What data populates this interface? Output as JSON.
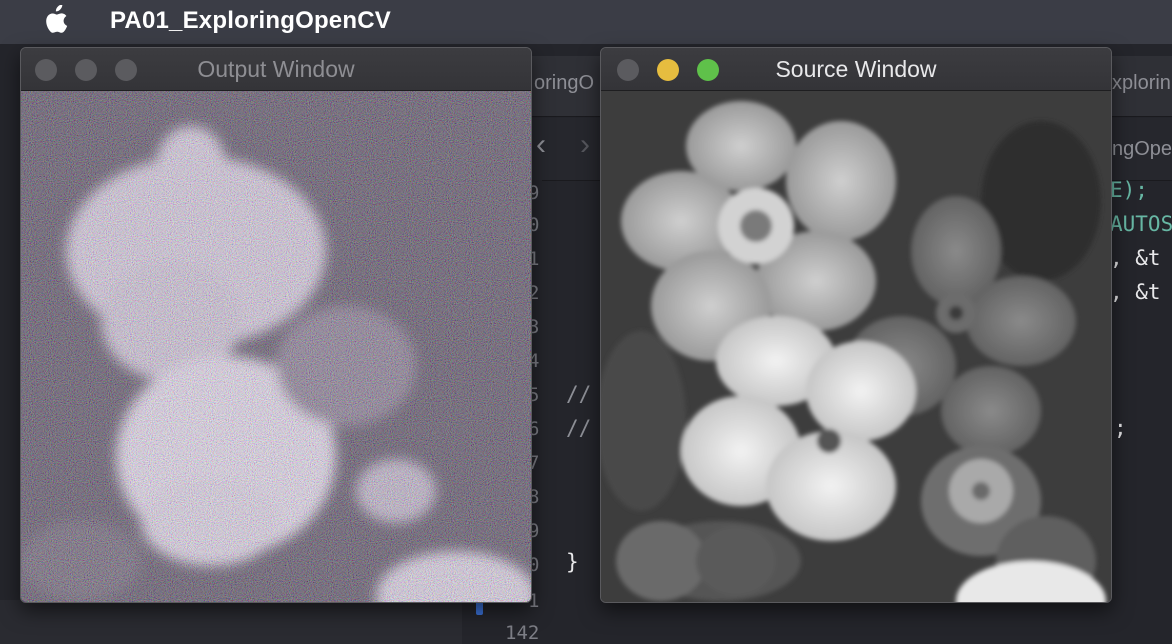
{
  "menubar": {
    "app_title": "PA01_ExploringOpenCV",
    "apple_icon": "apple-logo-icon"
  },
  "editor": {
    "tab_left": "oringO",
    "tab_right": "xplorin",
    "jump_bar": "ngOpe",
    "line_numbers": [
      "9",
      "0",
      "1",
      "2",
      "3",
      "4",
      "5",
      "6",
      "7",
      "8",
      "9",
      "0",
      "1",
      "142"
    ],
    "code_lines": [
      "E);",
      "AUTOS",
      ", &t",
      ", &t",
      "//",
      "//",
      ";",
      "}"
    ]
  },
  "output_window": {
    "title": "Output Window",
    "image_description": "noisy-flowers-image",
    "traffic_lights": [
      "#5b5b5f",
      "#5b5b5f",
      "#5b5b5f"
    ]
  },
  "source_window": {
    "title": "Source Window",
    "image_description": "grayscale-flowers-image",
    "traffic_lights": [
      "#5b5b5f",
      "#e6bd3f",
      "#5fc14a"
    ]
  },
  "colors": {
    "menubar": "#3b3d46",
    "editor_background": "#24252b",
    "code_green": "#67b7a4",
    "inactive_title": "#8e8e93",
    "active_title": "#e8e8ea"
  }
}
